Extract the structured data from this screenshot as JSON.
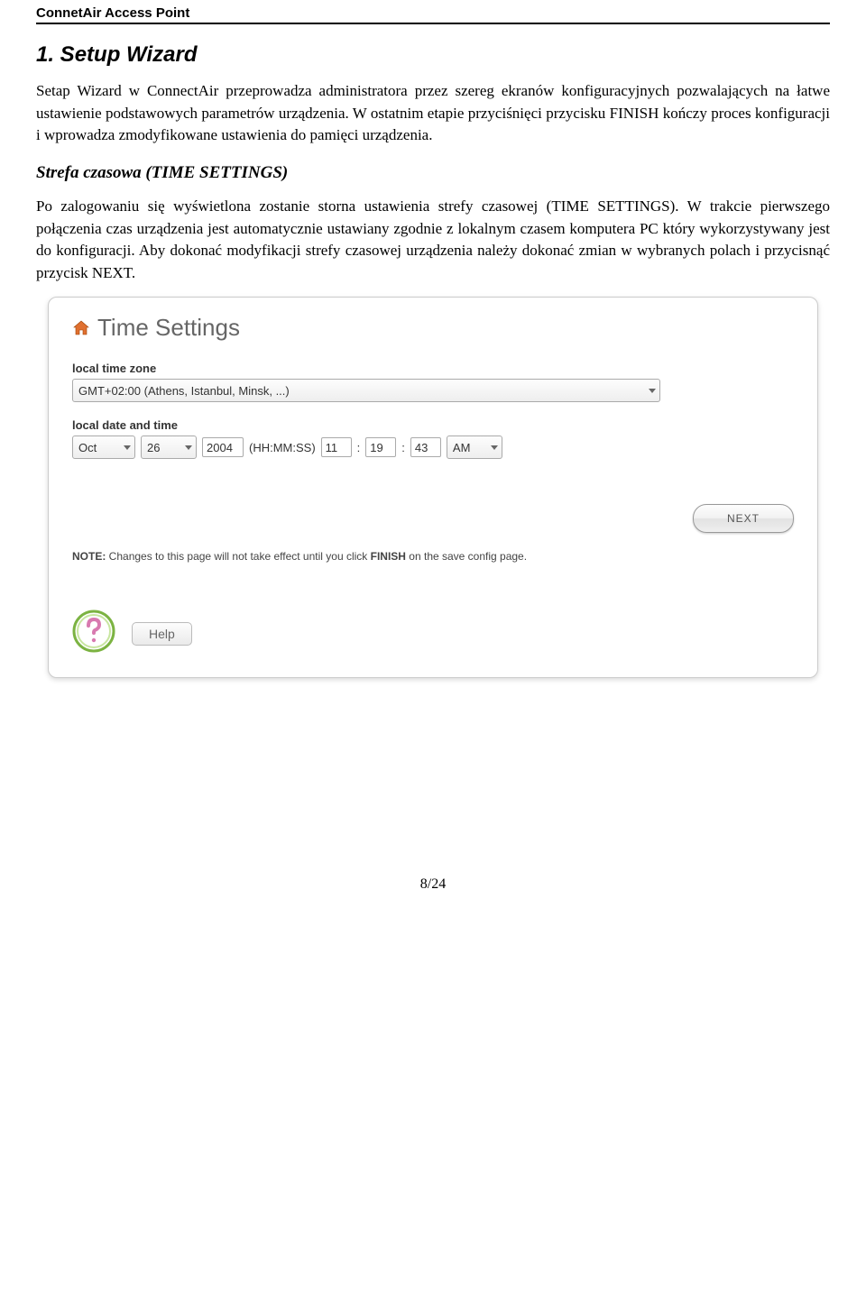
{
  "header": {
    "product": "ConnetAir Access Point"
  },
  "section": {
    "title": "1. Setup Wizard",
    "para1": "Setap Wizard w ConnectAir przeprowadza administratora przez szereg ekranów konfiguracyjnych pozwalających na łatwe ustawienie podstawowych parametrów urządzenia. W ostatnim etapie przyciśnięci przycisku FINISH kończy proces konfiguracji i wprowadza zmodyfikowane ustawienia do pamięci urządzenia.",
    "subheading": "Strefa czasowa (TIME SETTINGS)",
    "para2": "Po zalogowaniu się wyświetlona zostanie storna ustawienia strefy czasowej (TIME SETTINGS). W trakcie pierwszego połączenia czas urządzenia jest automatycznie ustawiany zgodnie z lokalnym czasem komputera PC który wykorzystywany jest do konfiguracji. Aby dokonać modyfikacji strefy czasowej urządzenia należy dokonać zmian w wybranych polach i przycisnąć przycisk NEXT."
  },
  "panel": {
    "title": "Time Settings",
    "tz_label": "local time zone",
    "tz_value": "GMT+02:00 (Athens, Istanbul, Minsk, ...)",
    "dt_label": "local date and time",
    "month": "Oct",
    "day": "26",
    "year": "2004",
    "hhmmss": "(HH:MM:SS)",
    "hh": "11",
    "mm": "19",
    "ss": "43",
    "ampm": "AM",
    "sep": ":",
    "next": "NEXT",
    "note_bold1": "NOTE:",
    "note_text": " Changes to this page will not take effect until you click ",
    "note_bold2": "FINISH",
    "note_tail": " on the save config page.",
    "help": "Help"
  },
  "footer": {
    "pagenum": "8/24"
  }
}
